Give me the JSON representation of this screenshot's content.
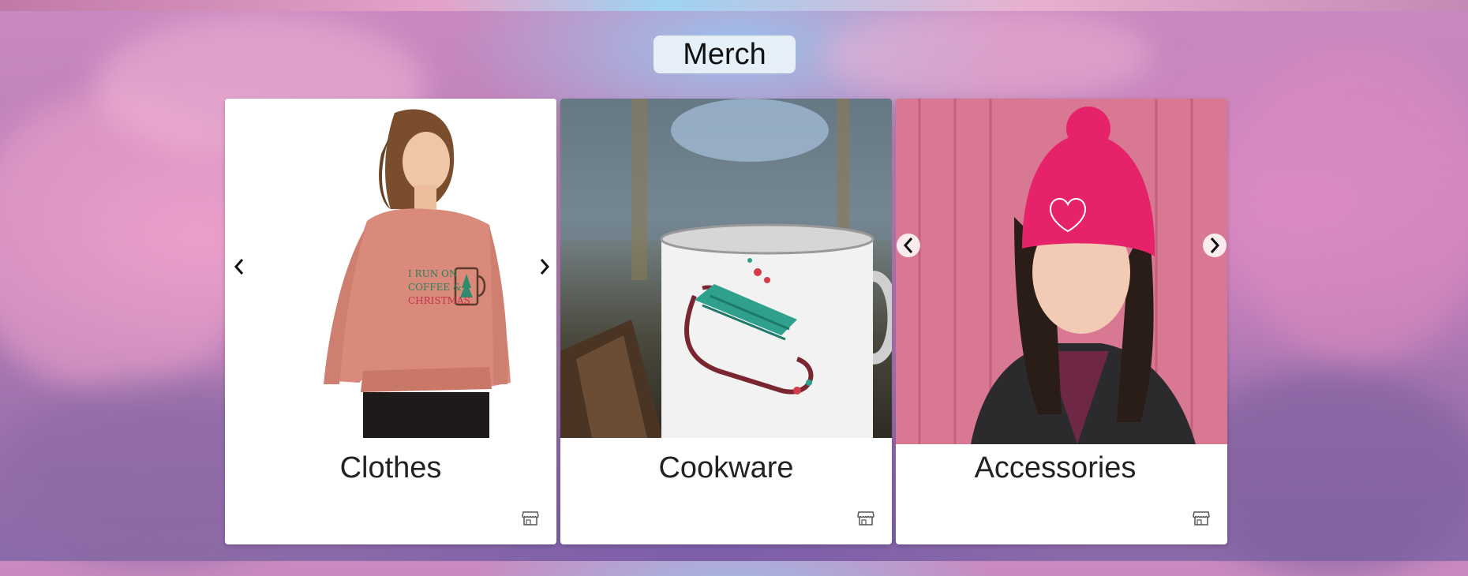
{
  "page": {
    "title": "Merch"
  },
  "carousel_controls": {
    "prev_icon": "chevron-left-icon",
    "next_icon": "chevron-right-icon"
  },
  "cards": [
    {
      "title": "Clothes",
      "image": "woman in pink cropped sweatshirt",
      "sweatshirt_text": [
        "I RUN ON",
        "COFFEE &",
        "CHRISTMAS"
      ],
      "icon": "storefront-icon"
    },
    {
      "title": "Cookware",
      "image": "enamel mug with sled design",
      "icon": "storefront-icon"
    },
    {
      "title": "Accessories",
      "image": "woman wearing pink beanie",
      "icon": "storefront-icon"
    }
  ]
}
